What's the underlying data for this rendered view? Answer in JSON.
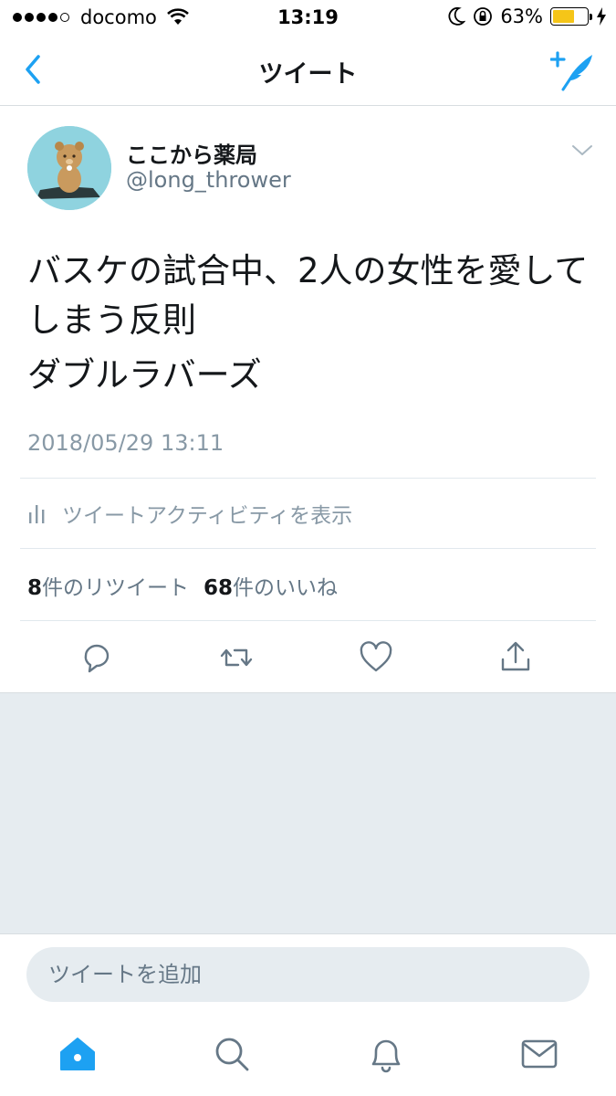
{
  "status_bar": {
    "carrier": "docomo",
    "time": "13:19",
    "battery_percent": "63%",
    "battery_level": 0.63
  },
  "nav": {
    "title": "ツイート",
    "back_icon": "chevron-left-icon",
    "compose_icon": "compose-tweet-icon"
  },
  "tweet": {
    "display_name": "ここから薬局",
    "handle": "@long_thrower",
    "text_lines": [
      "バスケの試合中、2人の女性を愛してしまう反則",
      "ダブルラバーズ"
    ],
    "timestamp": "2018/05/29 13:11",
    "activity_label": "ツイートアクティビティを表示",
    "retweet_count": "8",
    "retweet_label": "件のリツイート",
    "like_count": "68",
    "like_label": "件のいいね"
  },
  "reply": {
    "placeholder": "ツイートを追加"
  },
  "tabs": [
    "home-icon",
    "search-icon",
    "notifications-icon",
    "messages-icon"
  ],
  "colors": {
    "accent": "#1da1f2",
    "secondary_text": "#657786",
    "background_grey": "#e6ecf0"
  }
}
